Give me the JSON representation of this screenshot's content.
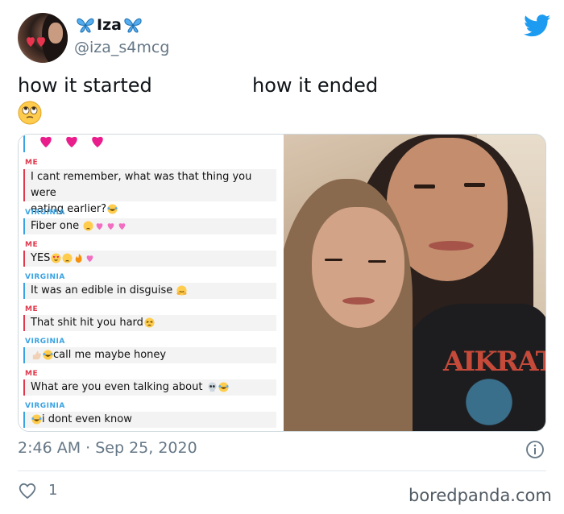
{
  "author": {
    "display_name": "Iza",
    "handle": "@iza_s4mcg"
  },
  "tweet": {
    "text_left": "how it started",
    "text_right": "how it ended",
    "emoji": "rolling-eyes-emoji"
  },
  "chat": {
    "messages": [
      {
        "sender": "ME",
        "text": "I cant remember, what was that thing you were eating earlier?",
        "line1": "I cant remember, what was that thing you were",
        "line2": "eating earlier?",
        "emoji": [
          "laughing-crying-emoji"
        ]
      },
      {
        "sender": "VIRGINIA",
        "text": "Fiber one",
        "emoji": [
          "weary-emoji",
          "heart-emoji",
          "heart-emoji",
          "heart-emoji"
        ]
      },
      {
        "sender": "ME",
        "text": "YES",
        "emoji": [
          "heart-eyes-emoji",
          "weary-emoji",
          "fire-emoji",
          "heart-emoji"
        ]
      },
      {
        "sender": "VIRGINIA",
        "text": "It was an edible in disguise",
        "emoji": [
          "hugging-emoji"
        ]
      },
      {
        "sender": "ME",
        "text": "That shit hit you hard",
        "emoji": [
          "tired-emoji"
        ]
      },
      {
        "sender": "VIRGINIA",
        "text": "call me maybe honey",
        "emoji": [
          "thumbs-up-emoji",
          "laughing-crying-emoji"
        ]
      },
      {
        "sender": "ME",
        "text": "What are you even talking about",
        "emoji": [
          "skull-emoji",
          "laughing-crying-emoji"
        ]
      },
      {
        "sender": "VIRGINIA",
        "text": "i dont even know",
        "emoji": [
          "laughing-crying-emoji"
        ]
      }
    ]
  },
  "photo": {
    "shirt_text": "AIKRAT"
  },
  "meta": {
    "timestamp": "2:46 AM · Sep 25, 2020",
    "like_count": "1",
    "watermark": "boredpanda.com"
  },
  "colors": {
    "twitter_blue": "#1d9bf0",
    "me_red": "#e0384c",
    "virginia_blue": "#3aa3e3",
    "muted_text": "#657786"
  }
}
